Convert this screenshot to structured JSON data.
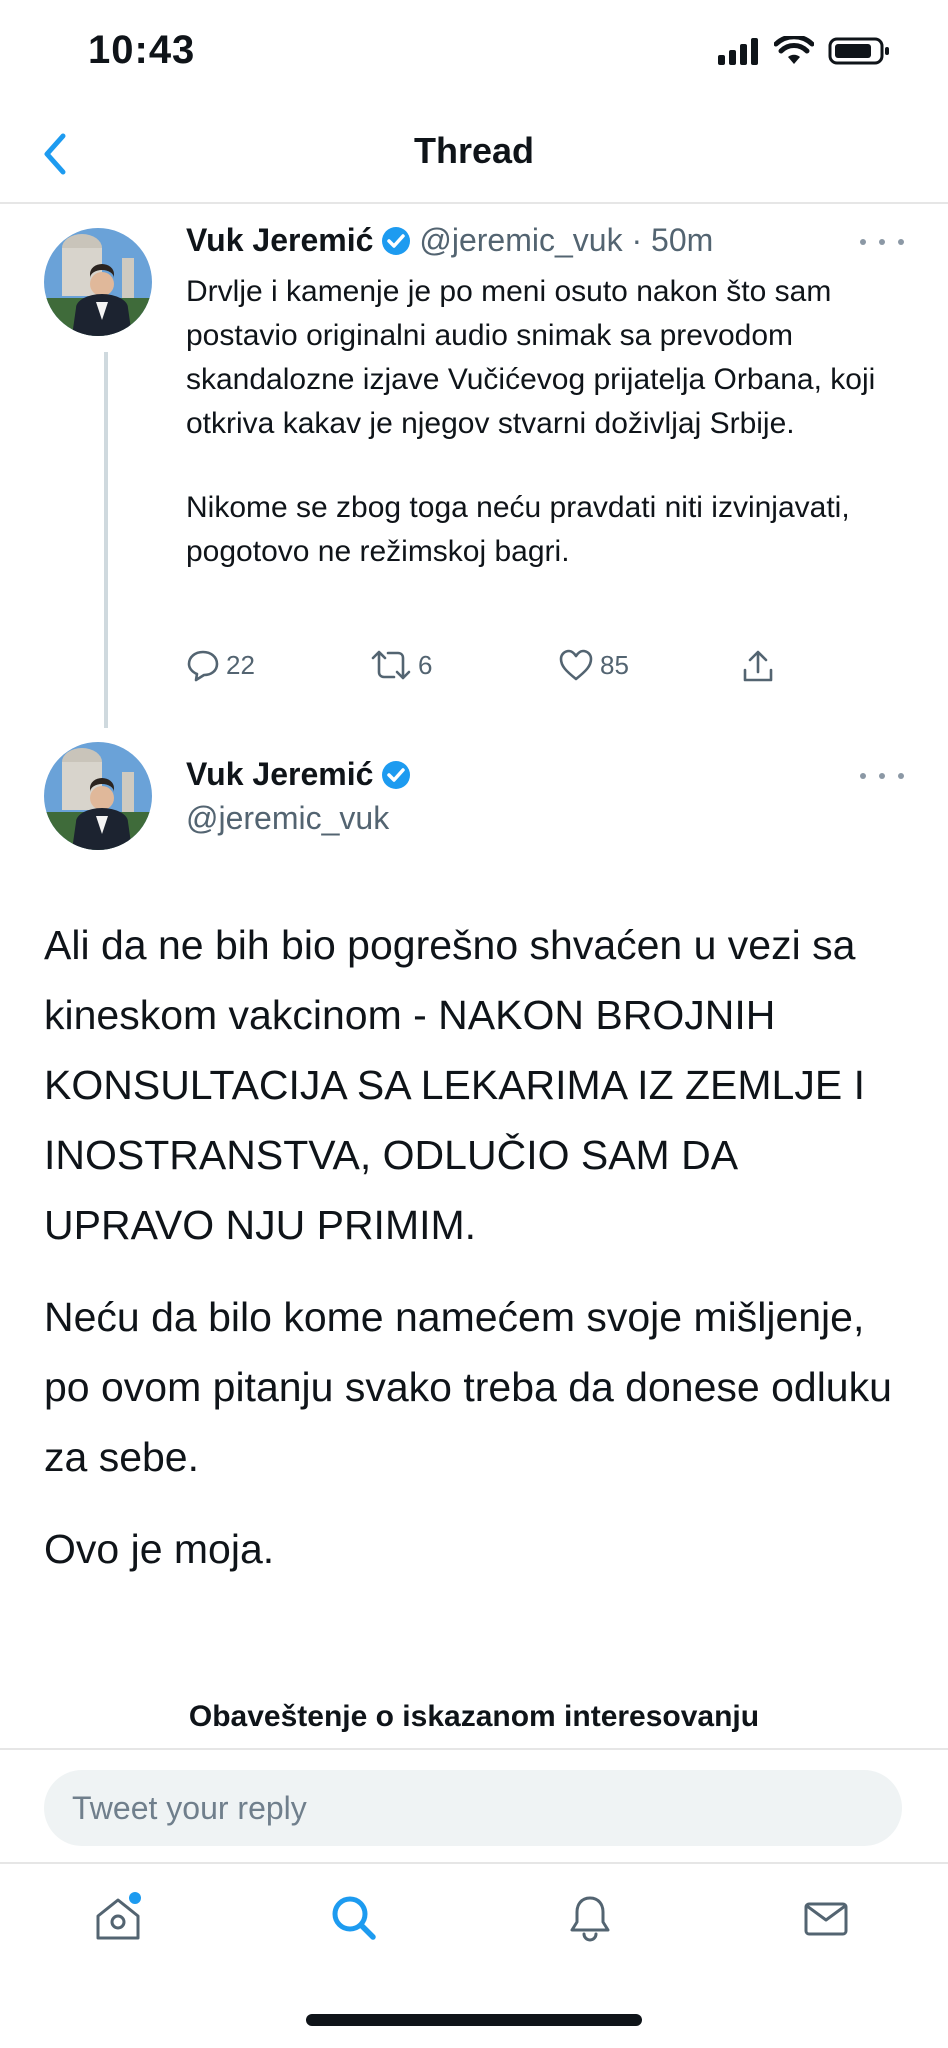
{
  "status_bar": {
    "time": "10:43"
  },
  "header": {
    "title": "Thread"
  },
  "tweet1": {
    "name": "Vuk Jeremić",
    "handle_time": "@jeremic_vuk · 50m",
    "paragraphs": [
      "Drvlje i kamenje je po meni osuto nakon što sam postavio originalni audio snimak sa prevodom skandalozne izjave Vučićevog prijatelja Orbana, koji otkriva kakav je njegov stvarni doživljaj Srbije.",
      "Nikome se zbog toga neću pravdati niti izvinjavati, pogotovo ne režimskoj bagri."
    ],
    "replies": "22",
    "retweets": "6",
    "likes": "85"
  },
  "tweet2": {
    "name": "Vuk Jeremić",
    "handle": "@jeremic_vuk",
    "paragraphs": [
      "Ali da ne bih bio pogrešno shvaćen u vezi sa kineskom vakcinom - NAKON BROJNIH KONSULTACIJA SA LEKARIMA IZ ZEMLJE I INOSTRANSTVA, ODLUČIO SAM DA UPRAVO NJU PRIMIM.",
      "Neću da bilo kome namećem svoje mišljenje, po ovom pitanju svako treba da donese odluku za sebe.",
      "Ovo je moja."
    ],
    "notice": "Obaveštenje o iskazanom interesovanju"
  },
  "reply": {
    "placeholder": "Tweet your reply"
  },
  "nav": {
    "items": [
      "home-icon",
      "search-icon",
      "bell-icon",
      "mail-icon"
    ]
  },
  "colors": {
    "accent": "#1d9bf0",
    "muted": "#536471",
    "text": "#0f1419"
  }
}
